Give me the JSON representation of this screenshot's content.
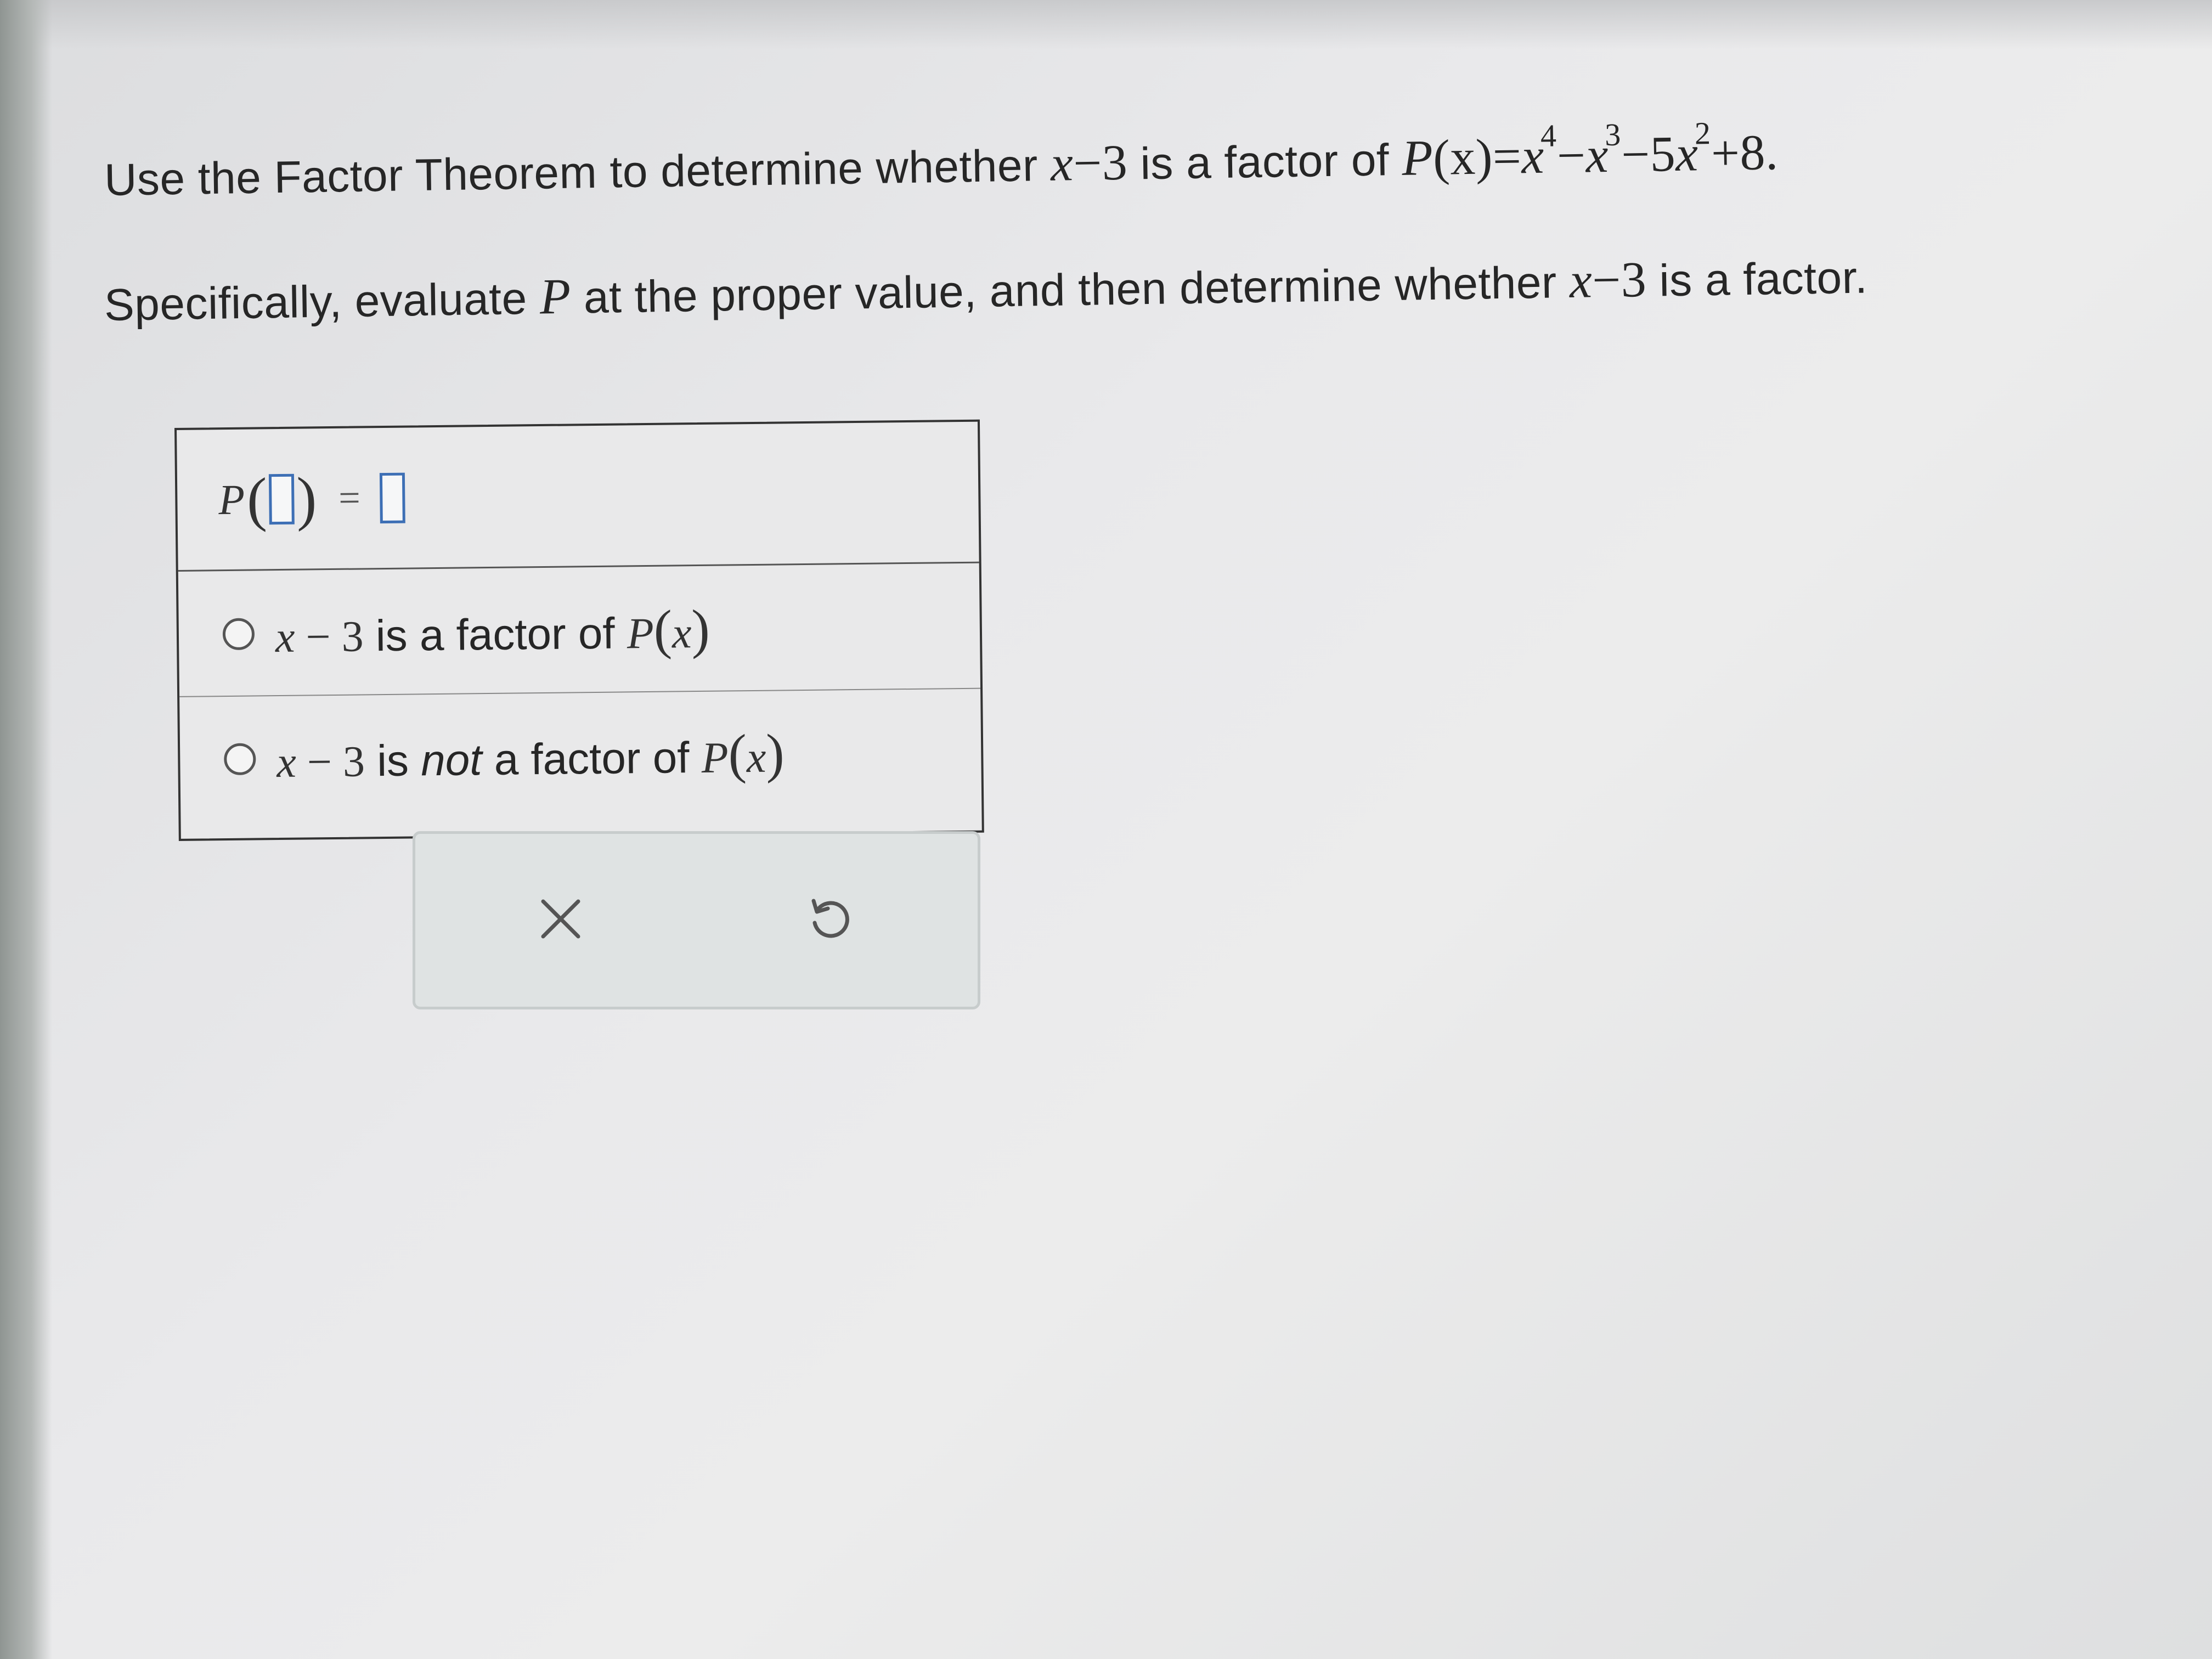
{
  "question": {
    "line1_text": "Use the Factor Theorem to determine whether",
    "line1_divisor_var": "x",
    "line1_divisor_rest": "−3",
    "line1_mid_text": "is a factor of",
    "poly_name": "P",
    "poly_arg": "(x)",
    "poly_eq": "=",
    "poly_t1_base": "x",
    "poly_t1_exp": "4",
    "poly_t2_sign": "−",
    "poly_t2_base": "x",
    "poly_t2_exp": "3",
    "poly_t3_sign": "−",
    "poly_t3_coef": "5",
    "poly_t3_base": "x",
    "poly_t3_exp": "2",
    "poly_t4": "+8.",
    "line2_pre": "Specifically, evaluate",
    "line2_var": "P",
    "line2_mid": "at the proper value, and then determine whether",
    "line2_divisor_var": "x",
    "line2_divisor_rest": "−3",
    "line2_post": "is a factor."
  },
  "answer": {
    "eval_name": "P",
    "eval_open": "(",
    "eval_close": ")",
    "eval_eq": "=",
    "options": [
      {
        "var": "x",
        "rest": "− 3",
        "text_pre": "is a factor of",
        "emph": "",
        "text_post": "",
        "fn": "P",
        "arg_open": "(",
        "arg": "x",
        "arg_close": ")",
        "selected": false
      },
      {
        "var": "x",
        "rest": "− 3",
        "text_pre": "is",
        "emph": "not",
        "text_post": "a factor of",
        "fn": "P",
        "arg_open": "(",
        "arg": "x",
        "arg_close": ")",
        "selected": false
      }
    ]
  },
  "actions": {
    "clear_icon": "close-icon",
    "undo_icon": "undo-icon"
  },
  "colors": {
    "input_border": "#3d6fb5",
    "panel_bg": "#dfe3e3",
    "text": "#262626"
  }
}
